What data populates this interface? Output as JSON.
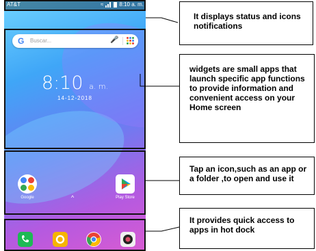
{
  "status_bar": {
    "carrier": "AT&T",
    "time": "8:10 a. m."
  },
  "search": {
    "placeholder": "Buscar..."
  },
  "clock": {
    "time": "8:10",
    "ampm": "a. m.",
    "date": "14-12-2018"
  },
  "apps": [
    {
      "label": "Google",
      "icon": "google-folder-icon"
    },
    {
      "label": "Play Store",
      "icon": "play-store-icon"
    }
  ],
  "dock": [
    {
      "icon": "phone-icon",
      "color": "#1db954"
    },
    {
      "icon": "messages-icon",
      "color": "#f6b400"
    },
    {
      "icon": "chrome-icon",
      "color": "#e8443a"
    },
    {
      "icon": "camera-icon",
      "color": "#d94c67"
    }
  ],
  "callouts": {
    "status": "It displays status and icons notifications",
    "widgets": "widgets are small apps that launch specific app functions to provide information and convenient access on your Home screen",
    "apps": "Tap an icon,such as an app or a folder ,to open and use it",
    "dock": "It provides quick access to apps in hot dock"
  }
}
